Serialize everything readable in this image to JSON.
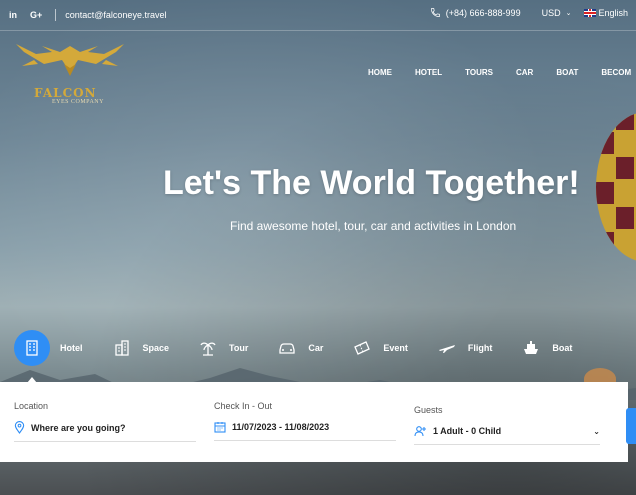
{
  "topbar": {
    "social": [
      "in",
      "G+"
    ],
    "email": "contact@falconeye.travel",
    "phone": "(+84) 666-888-999",
    "currency": "USD",
    "language": "English"
  },
  "logo": {
    "word": "FALCON",
    "sub": "EYES COMPANY"
  },
  "nav": {
    "items": [
      "HOME",
      "HOTEL",
      "TOURS",
      "CAR",
      "BOAT",
      "BECOM"
    ]
  },
  "hero": {
    "title": "Let's The World Together!",
    "subtitle": "Find awesome hotel, tour, car and activities in London"
  },
  "categories": [
    {
      "label": "Hotel",
      "icon": "hotel-icon",
      "active": true
    },
    {
      "label": "Space",
      "icon": "building-icon",
      "active": false
    },
    {
      "label": "Tour",
      "icon": "palm-tree-icon",
      "active": false
    },
    {
      "label": "Car",
      "icon": "car-icon",
      "active": false
    },
    {
      "label": "Event",
      "icon": "ticket-icon",
      "active": false
    },
    {
      "label": "Flight",
      "icon": "plane-icon",
      "active": false
    },
    {
      "label": "Boat",
      "icon": "boat-icon",
      "active": false
    }
  ],
  "search": {
    "location_label": "Location",
    "location_value": "Where are you going?",
    "dates_label": "Check In - Out",
    "dates_value": "11/07/2023 - 11/08/2023",
    "guests_label": "Guests",
    "guests_value": "1 Adult - 0 Child"
  },
  "colors": {
    "accent": "#2f8ef5",
    "logo_gold": "#d4a93a"
  }
}
